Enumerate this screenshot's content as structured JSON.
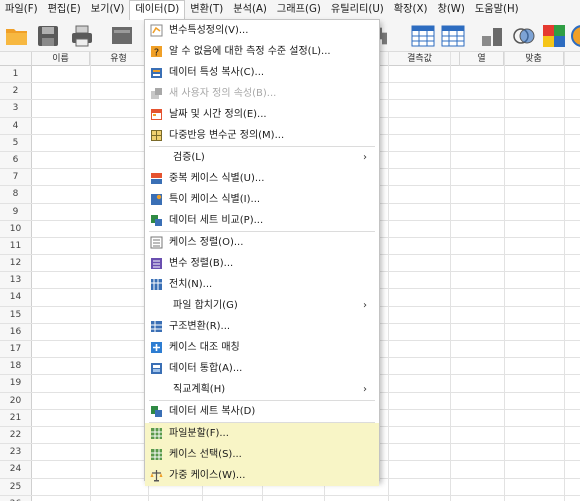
{
  "menubar": {
    "items": [
      {
        "label": "파일(F)"
      },
      {
        "label": "편집(E)"
      },
      {
        "label": "보기(V)"
      },
      {
        "label": "데이터(D)"
      },
      {
        "label": "변환(T)"
      },
      {
        "label": "분석(A)"
      },
      {
        "label": "그래프(G)"
      },
      {
        "label": "유틸리티(U)"
      },
      {
        "label": "확장(X)"
      },
      {
        "label": "창(W)"
      },
      {
        "label": "도움말(H)"
      }
    ]
  },
  "grid": {
    "columns": [
      "이름",
      "유형",
      "결측값",
      "열",
      "맞춤"
    ],
    "row_numbers": [
      "1",
      "2",
      "3",
      "4",
      "5",
      "6",
      "7",
      "8",
      "9",
      "10",
      "11",
      "12",
      "13",
      "14",
      "15",
      "16",
      "17",
      "18",
      "19",
      "20",
      "21",
      "22",
      "23",
      "24",
      "25",
      "26"
    ]
  },
  "data_menu": {
    "items": [
      {
        "label": "변수특성정의(V)...",
        "icon": "variable-properties-icon"
      },
      {
        "label": "알 수 없음에 대한 측정 수준 설정(L)...",
        "icon": "measurement-level-icon"
      },
      {
        "label": "데이터 특성 복사(C)...",
        "icon": "copy-properties-icon"
      },
      {
        "label": "새 사용자 정의 속성(B)...",
        "icon": "custom-attribute-icon",
        "disabled": true
      },
      {
        "label": "날짜 및 시간 정의(E)...",
        "icon": "calendar-icon"
      },
      {
        "label": "다중반응 변수군 정의(M)...",
        "icon": "multiple-response-icon"
      },
      {
        "label": "검증(L)",
        "submenu": true
      },
      {
        "label": "중복 케이스 식별(U)...",
        "icon": "duplicate-cases-icon"
      },
      {
        "label": "특이 케이스 식별(I)...",
        "icon": "unusual-cases-icon"
      },
      {
        "label": "데이터 세트 비교(P)...",
        "icon": "compare-datasets-icon"
      },
      {
        "label": "케이스 정렬(O)...",
        "icon": "sort-cases-icon"
      },
      {
        "label": "변수 정렬(B)...",
        "icon": "sort-variables-icon"
      },
      {
        "label": "전치(N)...",
        "icon": "transpose-icon"
      },
      {
        "label": "파일 합치기(G)",
        "submenu": true
      },
      {
        "label": "구조변환(R)...",
        "icon": "restructure-icon"
      },
      {
        "label": "케이스 대조 매칭",
        "icon": "case-control-icon"
      },
      {
        "label": "데이터 통합(A)...",
        "icon": "aggregate-icon"
      },
      {
        "label": "직교계획(H)",
        "submenu": true
      },
      {
        "label": "데이터 세트 복사(D)",
        "icon": "copy-dataset-icon"
      },
      {
        "label": "파일분할(F)...",
        "icon": "split-file-icon",
        "highlight": true
      },
      {
        "label": "케이스 선택(S)...",
        "icon": "select-cases-icon",
        "highlight": true
      },
      {
        "label": "가중 케이스(W)...",
        "icon": "weight-cases-icon",
        "highlight": true
      }
    ],
    "submenu_arrow": "›"
  },
  "colors": {
    "menubar_bg": "#f5f5f5",
    "highlight": "#f8f5c6",
    "disabled_text": "#a8a8a8",
    "folder_orange": "#f0a028"
  }
}
